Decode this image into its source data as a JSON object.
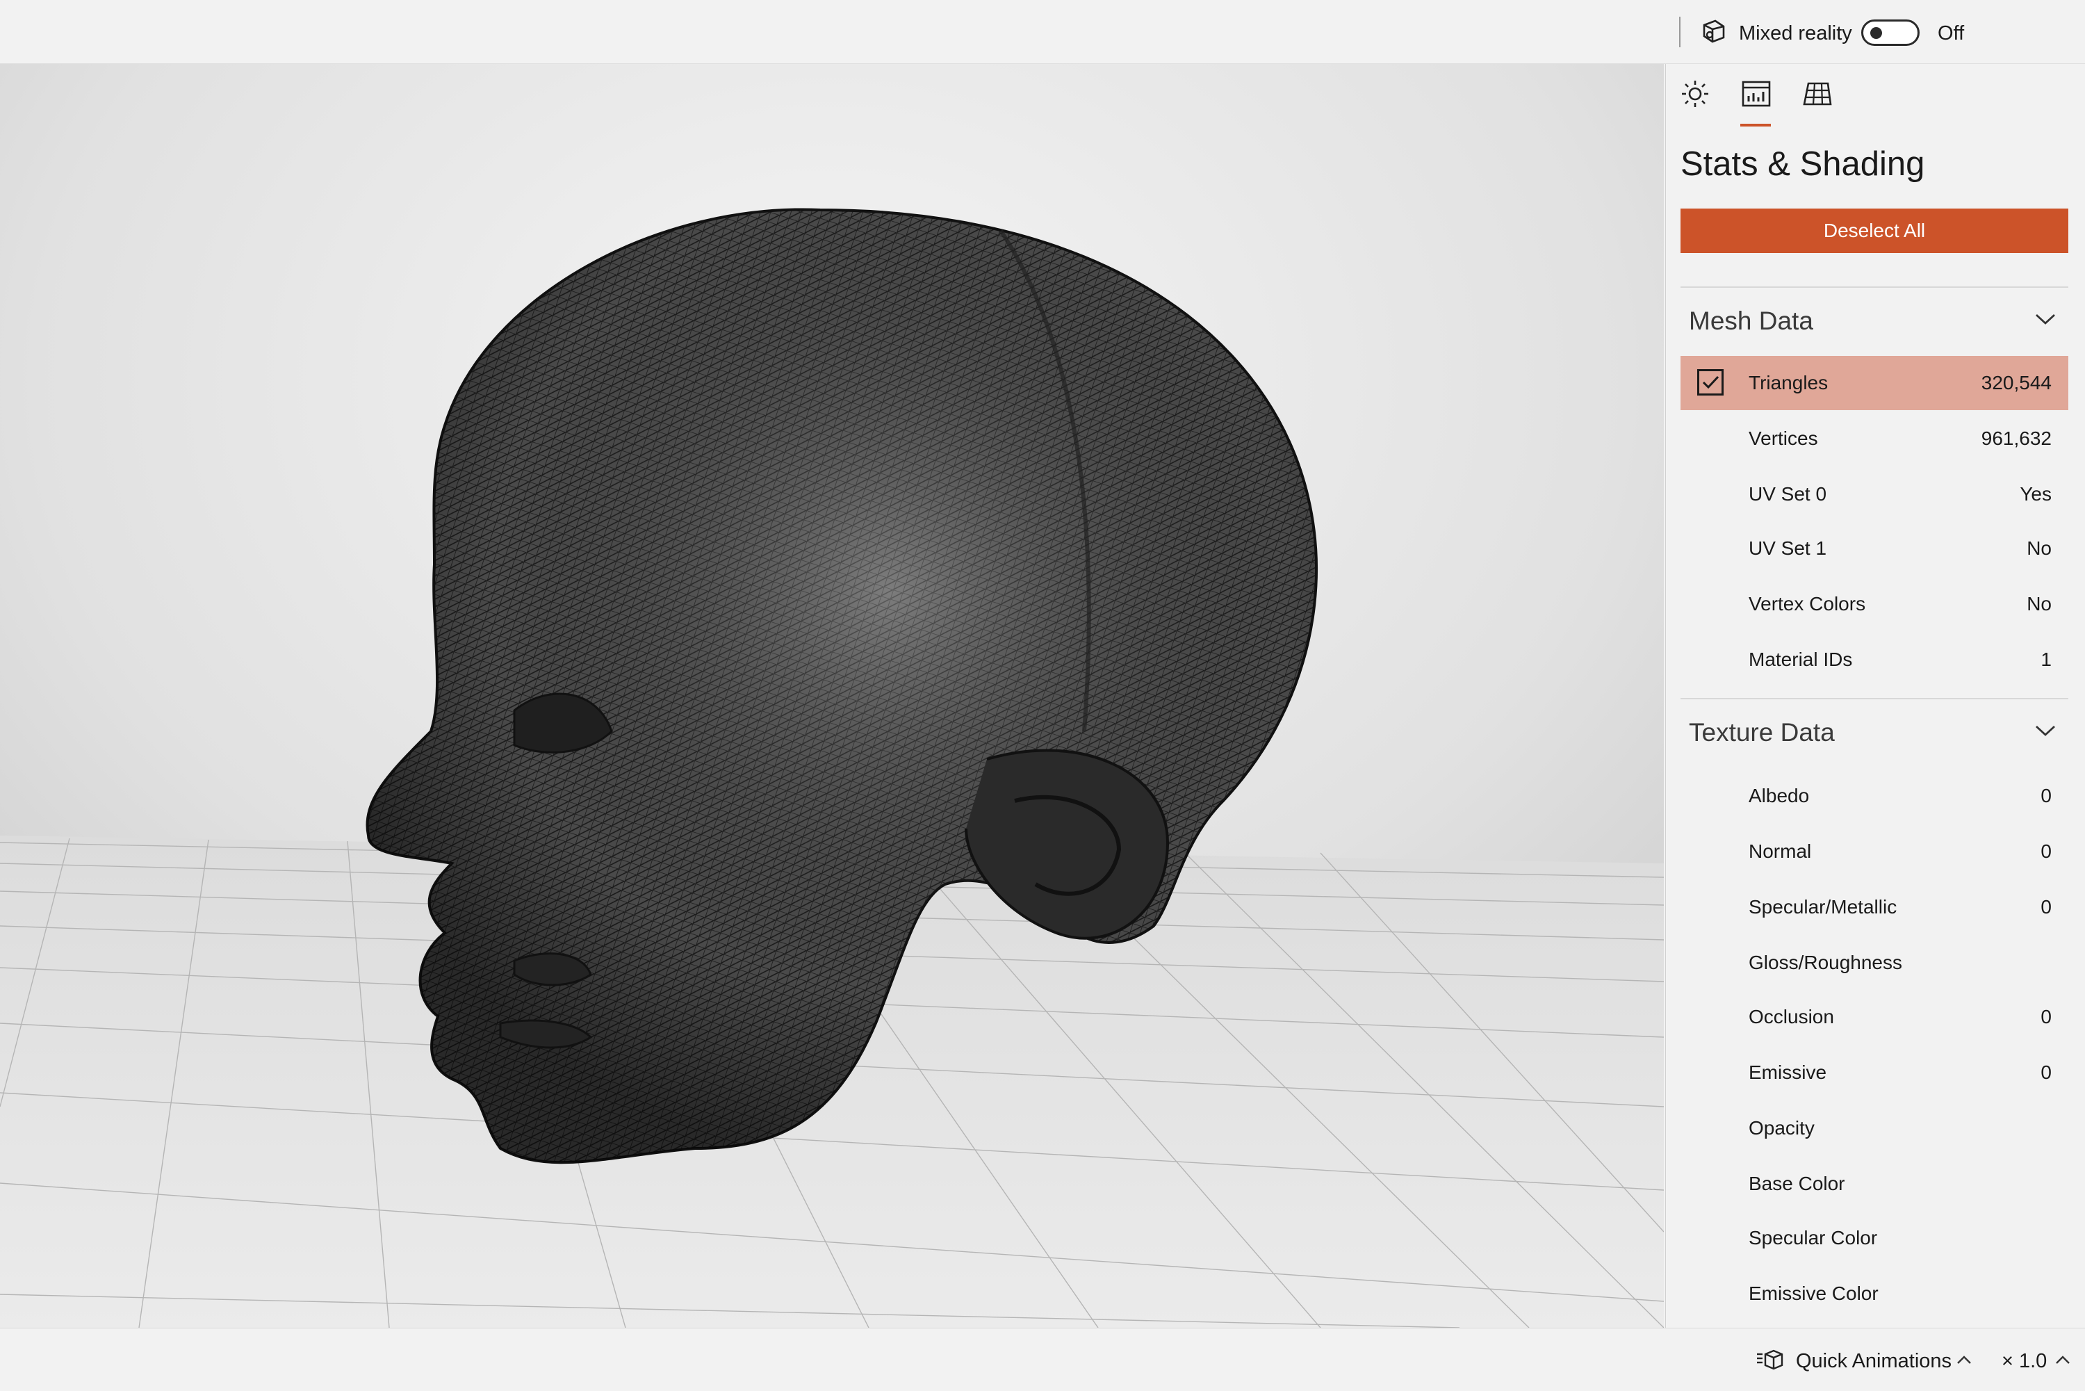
{
  "header": {
    "mixed_reality_label": "Mixed reality",
    "mixed_reality_state": "Off",
    "mixed_reality_icon": "mixed-reality-icon"
  },
  "panel": {
    "tabs": [
      {
        "icon": "sun-icon",
        "selected": false
      },
      {
        "icon": "stats-chart-icon",
        "selected": true
      },
      {
        "icon": "grid-icon",
        "selected": false
      }
    ],
    "title": "Stats & Shading",
    "deselect_label": "Deselect All",
    "accent_color": "#cc5329",
    "selected_row_color": "#e0a798",
    "mesh": {
      "title": "Mesh Data",
      "rows": [
        {
          "label": "Triangles",
          "value": "320,544",
          "checked": true
        },
        {
          "label": "Vertices",
          "value": "961,632"
        },
        {
          "label": "UV Set 0",
          "value": "Yes"
        },
        {
          "label": "UV Set 1",
          "value": "No"
        },
        {
          "label": "Vertex Colors",
          "value": "No"
        },
        {
          "label": "Material IDs",
          "value": "1"
        }
      ]
    },
    "texture": {
      "title": "Texture Data",
      "rows": [
        {
          "label": "Albedo",
          "value": "0"
        },
        {
          "label": "Normal",
          "value": "0"
        },
        {
          "label": "Specular/Metallic",
          "value": "0"
        },
        {
          "label": "Gloss/Roughness",
          "value": ""
        },
        {
          "label": "Occlusion",
          "value": "0"
        },
        {
          "label": "Emissive",
          "value": "0"
        },
        {
          "label": "Opacity",
          "value": ""
        },
        {
          "label": "Base Color",
          "value": ""
        },
        {
          "label": "Specular Color",
          "value": ""
        },
        {
          "label": "Emissive Color",
          "value": ""
        }
      ]
    }
  },
  "footer": {
    "quick_animations_label": "Quick Animations",
    "quick_animations_icon": "animation-icon",
    "speed_label": "× 1.0"
  }
}
